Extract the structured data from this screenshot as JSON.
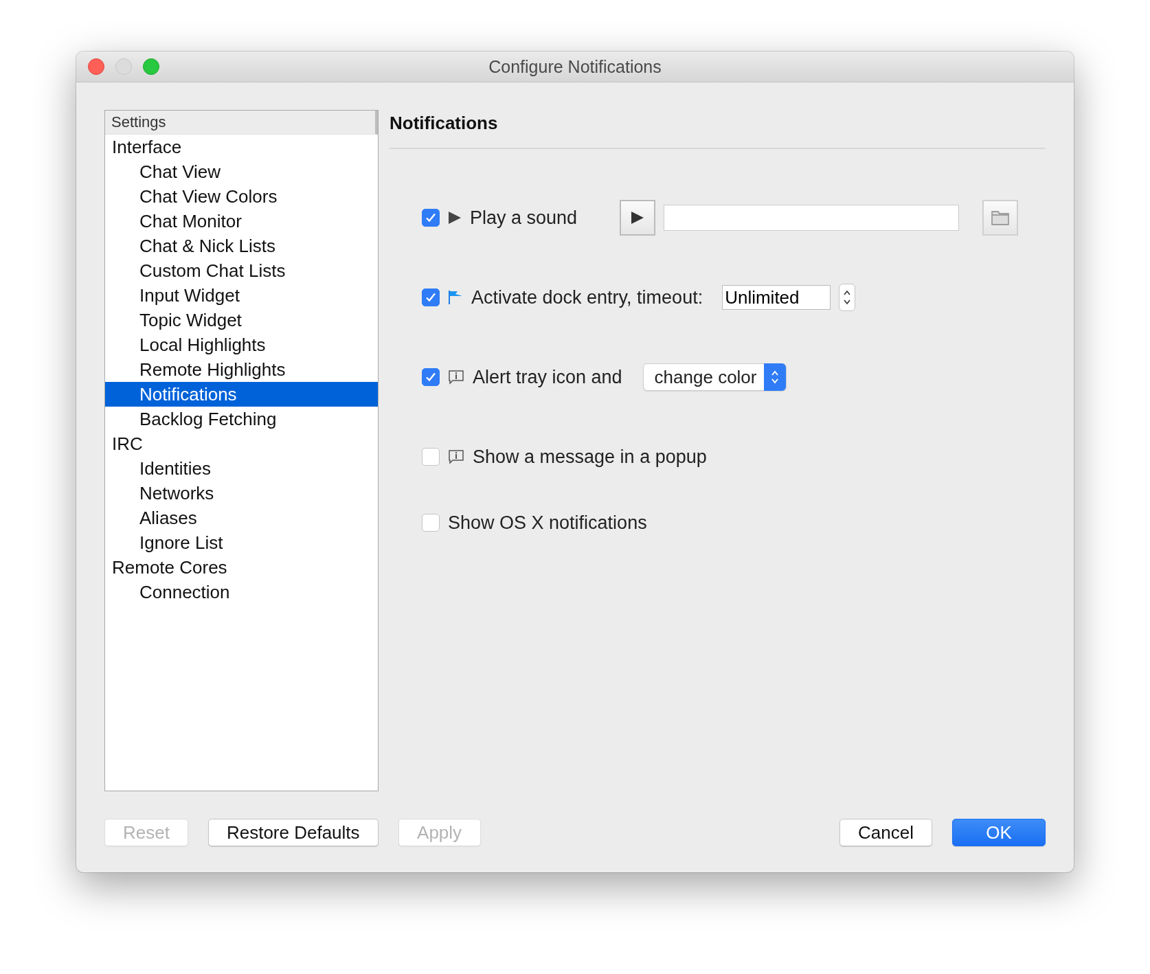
{
  "window": {
    "title": "Configure Notifications"
  },
  "sidebar": {
    "header": "Settings",
    "items": [
      {
        "label": "Interface",
        "selected": false,
        "children": [
          {
            "label": "Chat View",
            "selected": false
          },
          {
            "label": "Chat View Colors",
            "selected": false
          },
          {
            "label": "Chat Monitor",
            "selected": false
          },
          {
            "label": "Chat & Nick Lists",
            "selected": false
          },
          {
            "label": "Custom Chat Lists",
            "selected": false
          },
          {
            "label": "Input Widget",
            "selected": false
          },
          {
            "label": "Topic Widget",
            "selected": false
          },
          {
            "label": "Local Highlights",
            "selected": false
          },
          {
            "label": "Remote Highlights",
            "selected": false
          },
          {
            "label": "Notifications",
            "selected": true
          },
          {
            "label": "Backlog Fetching",
            "selected": false
          }
        ]
      },
      {
        "label": "IRC",
        "selected": false,
        "children": [
          {
            "label": "Identities",
            "selected": false
          },
          {
            "label": "Networks",
            "selected": false
          },
          {
            "label": "Aliases",
            "selected": false
          },
          {
            "label": "Ignore List",
            "selected": false
          }
        ]
      },
      {
        "label": "Remote Cores",
        "selected": false,
        "children": [
          {
            "label": "Connection",
            "selected": false
          }
        ]
      }
    ]
  },
  "panel": {
    "title": "Notifications",
    "options": [
      {
        "kind": "sound",
        "label": "Play a sound",
        "checked": true
      },
      {
        "kind": "dock",
        "label": "Activate dock entry, timeout:",
        "checked": true,
        "value": "Unlimited"
      },
      {
        "kind": "tray",
        "label": "Alert tray icon and",
        "checked": true,
        "value": "change color"
      },
      {
        "kind": "popup",
        "label": "Show a message in a popup",
        "checked": false
      },
      {
        "kind": "plain",
        "label": "Show OS X notifications",
        "checked": false
      }
    ]
  },
  "buttons_left": [
    {
      "label": "Reset",
      "disabled": true,
      "primary": false
    },
    {
      "label": "Restore Defaults",
      "disabled": false,
      "primary": false
    },
    {
      "label": "Apply",
      "disabled": true,
      "primary": false
    }
  ],
  "buttons_right": [
    {
      "label": "Cancel",
      "disabled": false,
      "primary": false
    },
    {
      "label": "OK",
      "disabled": false,
      "primary": true
    }
  ]
}
